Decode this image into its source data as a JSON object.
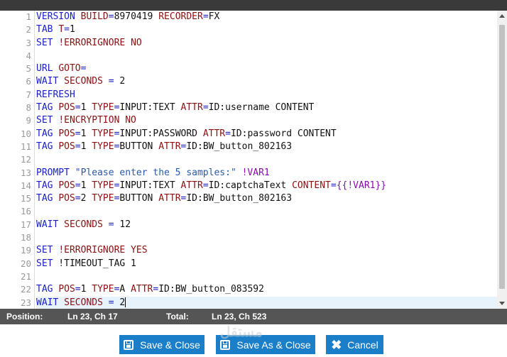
{
  "status": {
    "position_label": "Position:",
    "position_value": "Ln 23, Ch 17",
    "total_label": "Total:",
    "total_value": "Ln 23, Ch 523"
  },
  "buttons": {
    "save_close": "Save & Close",
    "save_as_close": "Save As & Close",
    "cancel": "Cancel"
  },
  "watermark": "مستقل",
  "colors": {
    "accent": "#1a7ec9",
    "status_bar": "#555555",
    "active_line": "#e8f2fb"
  },
  "lines": [
    {
      "n": "1",
      "toks": [
        [
          "cmd",
          "VERSION"
        ],
        [
          "val",
          " "
        ],
        [
          "attr",
          "BUILD"
        ],
        [
          "sym",
          "="
        ],
        [
          "val",
          "8970419 "
        ],
        [
          "attr",
          "RECORDER"
        ],
        [
          "sym",
          "="
        ],
        [
          "val",
          "FX"
        ]
      ]
    },
    {
      "n": "2",
      "toks": [
        [
          "cmd",
          "TAB"
        ],
        [
          "val",
          " "
        ],
        [
          "attr",
          "T"
        ],
        [
          "sym",
          "="
        ],
        [
          "val",
          "1"
        ]
      ]
    },
    {
      "n": "3",
      "toks": [
        [
          "cmd",
          "SET"
        ],
        [
          "val",
          " "
        ],
        [
          "attr",
          "!ERRORIGNORE"
        ],
        [
          "val",
          " "
        ],
        [
          "attr",
          "NO"
        ]
      ]
    },
    {
      "n": "4",
      "toks": []
    },
    {
      "n": "5",
      "toks": [
        [
          "cmd",
          "URL"
        ],
        [
          "val",
          " "
        ],
        [
          "attr",
          "GOTO"
        ],
        [
          "sym",
          "="
        ]
      ]
    },
    {
      "n": "6",
      "toks": [
        [
          "cmd",
          "WAIT"
        ],
        [
          "val",
          " "
        ],
        [
          "attr",
          "SECONDS"
        ],
        [
          "val",
          " "
        ],
        [
          "sym",
          "="
        ],
        [
          "val",
          " 2"
        ]
      ]
    },
    {
      "n": "7",
      "toks": [
        [
          "cmd",
          "REFRESH"
        ]
      ]
    },
    {
      "n": "8",
      "toks": [
        [
          "cmd",
          "TAG"
        ],
        [
          "val",
          " "
        ],
        [
          "attr",
          "POS"
        ],
        [
          "sym",
          "="
        ],
        [
          "val",
          "1 "
        ],
        [
          "attr",
          "TYPE"
        ],
        [
          "sym",
          "="
        ],
        [
          "val",
          "INPUT:TEXT "
        ],
        [
          "attr",
          "ATTR"
        ],
        [
          "sym",
          "="
        ],
        [
          "val",
          "ID:username CONTENT"
        ]
      ]
    },
    {
      "n": "9",
      "toks": [
        [
          "cmd",
          "SET"
        ],
        [
          "val",
          " "
        ],
        [
          "attr",
          "!ENCRYPTION"
        ],
        [
          "val",
          " "
        ],
        [
          "attr",
          "NO"
        ]
      ]
    },
    {
      "n": "10",
      "toks": [
        [
          "cmd",
          "TAG"
        ],
        [
          "val",
          " "
        ],
        [
          "attr",
          "POS"
        ],
        [
          "sym",
          "="
        ],
        [
          "val",
          "1 "
        ],
        [
          "attr",
          "TYPE"
        ],
        [
          "sym",
          "="
        ],
        [
          "val",
          "INPUT:PASSWORD "
        ],
        [
          "attr",
          "ATTR"
        ],
        [
          "sym",
          "="
        ],
        [
          "val",
          "ID:password CONTENT"
        ]
      ]
    },
    {
      "n": "11",
      "toks": [
        [
          "cmd",
          "TAG"
        ],
        [
          "val",
          " "
        ],
        [
          "attr",
          "POS"
        ],
        [
          "sym",
          "="
        ],
        [
          "val",
          "1 "
        ],
        [
          "attr",
          "TYPE"
        ],
        [
          "sym",
          "="
        ],
        [
          "val",
          "BUTTON "
        ],
        [
          "attr",
          "ATTR"
        ],
        [
          "sym",
          "="
        ],
        [
          "val",
          "ID:BW_button_802163"
        ]
      ]
    },
    {
      "n": "12",
      "toks": []
    },
    {
      "n": "13",
      "toks": [
        [
          "cmd",
          "PROMPT"
        ],
        [
          "val",
          " "
        ],
        [
          "str",
          "\"Please enter the 5 samples:\""
        ],
        [
          "val",
          " "
        ],
        [
          "var",
          "!VAR1"
        ]
      ]
    },
    {
      "n": "14",
      "toks": [
        [
          "cmd",
          "TAG"
        ],
        [
          "val",
          " "
        ],
        [
          "attr",
          "POS"
        ],
        [
          "sym",
          "="
        ],
        [
          "val",
          "1 "
        ],
        [
          "attr",
          "TYPE"
        ],
        [
          "sym",
          "="
        ],
        [
          "val",
          "INPUT:TEXT "
        ],
        [
          "attr",
          "ATTR"
        ],
        [
          "sym",
          "="
        ],
        [
          "val",
          "ID:captchaText "
        ],
        [
          "attr",
          "CONTENT"
        ],
        [
          "sym",
          "="
        ],
        [
          "var",
          "{{!VAR1}}"
        ]
      ]
    },
    {
      "n": "15",
      "toks": [
        [
          "cmd",
          "TAG"
        ],
        [
          "val",
          " "
        ],
        [
          "attr",
          "POS"
        ],
        [
          "sym",
          "="
        ],
        [
          "val",
          "2 "
        ],
        [
          "attr",
          "TYPE"
        ],
        [
          "sym",
          "="
        ],
        [
          "val",
          "BUTTON "
        ],
        [
          "attr",
          "ATTR"
        ],
        [
          "sym",
          "="
        ],
        [
          "val",
          "ID:BW_button_802163"
        ]
      ]
    },
    {
      "n": "16",
      "toks": []
    },
    {
      "n": "17",
      "toks": [
        [
          "cmd",
          "WAIT"
        ],
        [
          "val",
          " "
        ],
        [
          "attr",
          "SECONDS"
        ],
        [
          "val",
          " "
        ],
        [
          "sym",
          "="
        ],
        [
          "val",
          " 12"
        ]
      ]
    },
    {
      "n": "18",
      "toks": []
    },
    {
      "n": "19",
      "toks": [
        [
          "cmd",
          "SET"
        ],
        [
          "val",
          " "
        ],
        [
          "attr",
          "!ERRORIGNORE"
        ],
        [
          "val",
          " "
        ],
        [
          "attr",
          "YES"
        ]
      ]
    },
    {
      "n": "20",
      "toks": [
        [
          "cmd",
          "SET"
        ],
        [
          "val",
          " !TIMEOUT_TAG 1"
        ]
      ]
    },
    {
      "n": "21",
      "toks": []
    },
    {
      "n": "22",
      "toks": [
        [
          "cmd",
          "TAG"
        ],
        [
          "val",
          " "
        ],
        [
          "attr",
          "POS"
        ],
        [
          "sym",
          "="
        ],
        [
          "val",
          "1 "
        ],
        [
          "attr",
          "TYPE"
        ],
        [
          "sym",
          "="
        ],
        [
          "val",
          "A "
        ],
        [
          "attr",
          "ATTR"
        ],
        [
          "sym",
          "="
        ],
        [
          "val",
          "ID:BW_button_083592"
        ]
      ]
    },
    {
      "n": "23",
      "active": true,
      "toks": [
        [
          "cmd",
          "WAIT"
        ],
        [
          "val",
          " "
        ],
        [
          "attr",
          "SECONDS"
        ],
        [
          "val",
          " "
        ],
        [
          "sym",
          "="
        ],
        [
          "val",
          " 2"
        ]
      ]
    }
  ]
}
